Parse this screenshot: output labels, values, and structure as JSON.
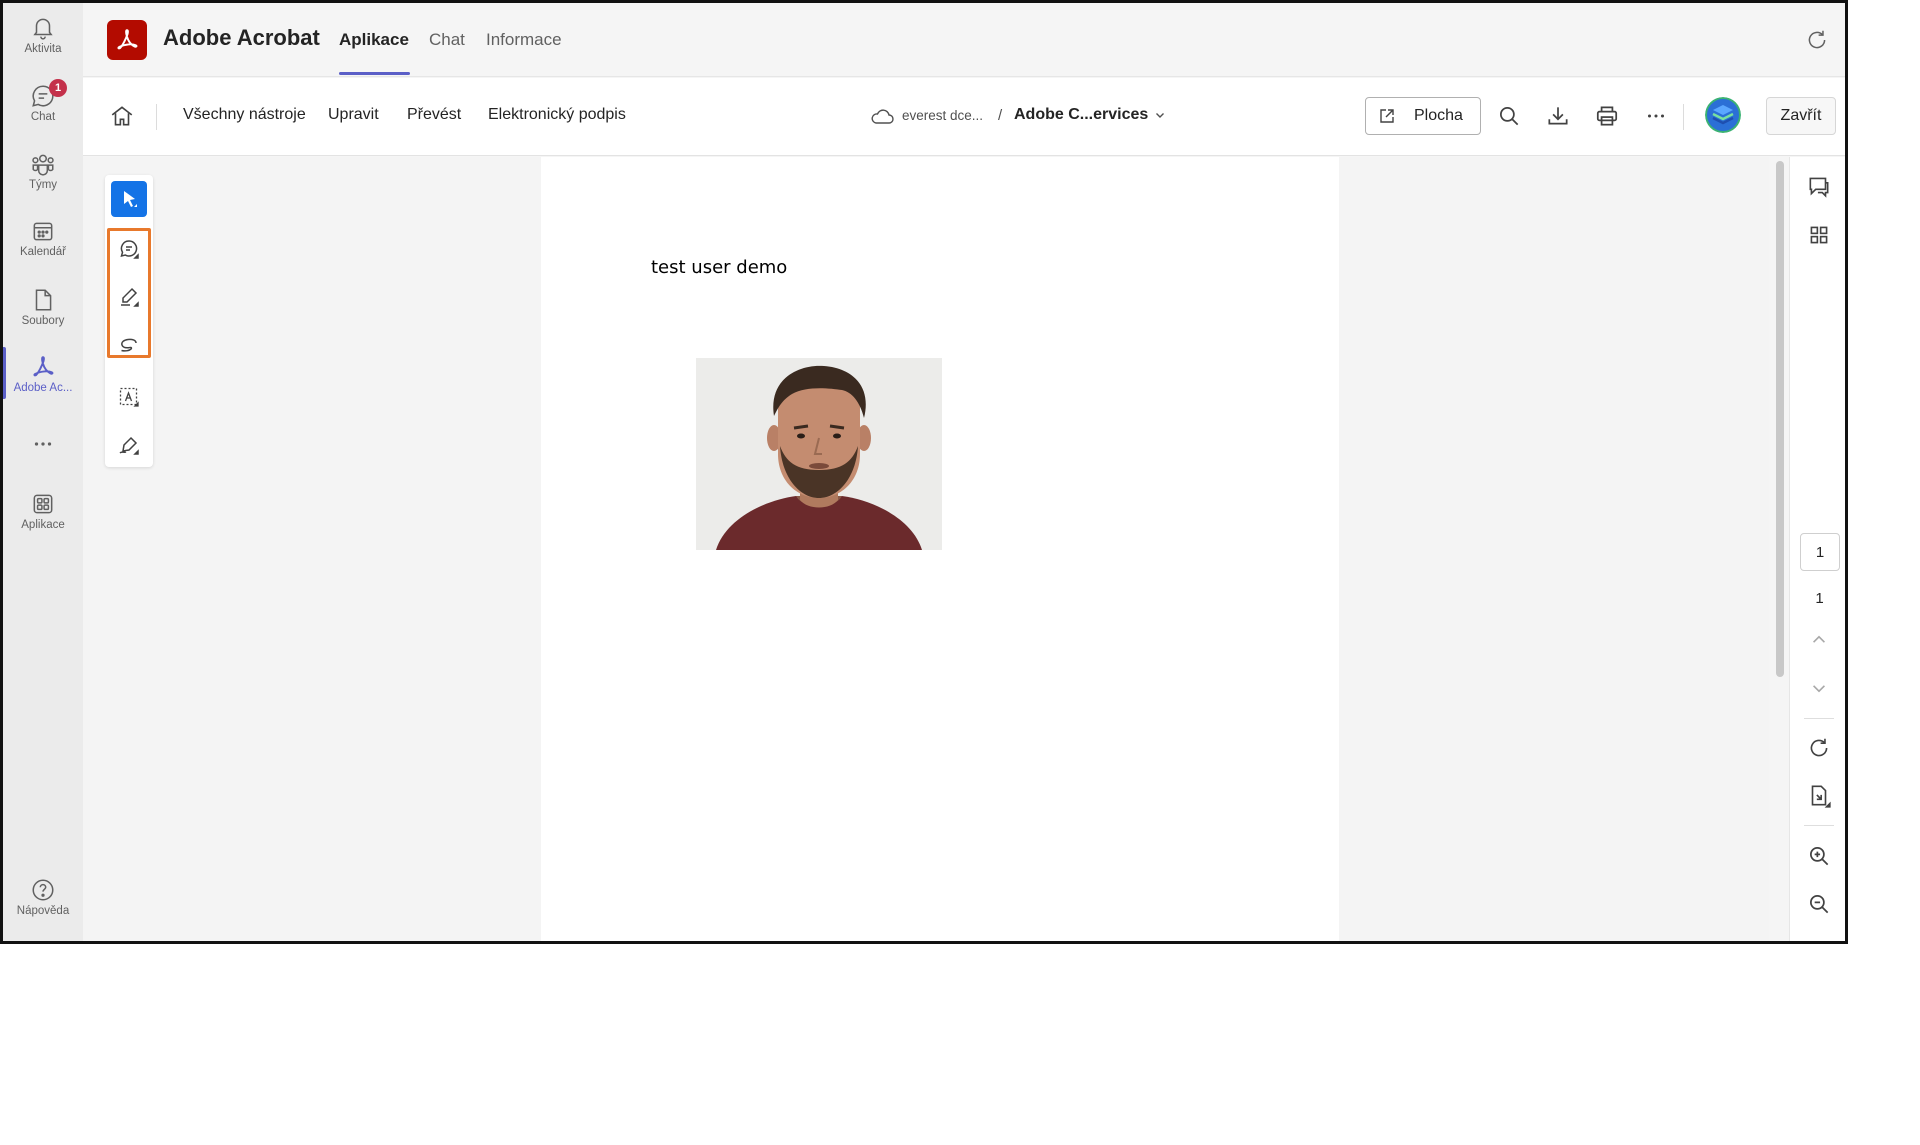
{
  "rail": {
    "items": [
      {
        "label": "Aktivita",
        "icon": "bell-icon"
      },
      {
        "label": "Chat",
        "icon": "chat-icon",
        "badge": "1"
      },
      {
        "label": "Týmy",
        "icon": "teams-icon"
      },
      {
        "label": "Kalendář",
        "icon": "calendar-icon"
      },
      {
        "label": "Soubory",
        "icon": "file-icon"
      },
      {
        "label": "Adobe Ac...",
        "icon": "acrobat-icon"
      },
      {
        "label": "",
        "icon": "more-horizontal-icon"
      },
      {
        "label": "Aplikace",
        "icon": "apps-icon"
      }
    ],
    "help_label": "Nápověda",
    "active_color": "#5b5fc7"
  },
  "header": {
    "app_title": "Adobe Acrobat",
    "tabs": [
      {
        "label": "Aplikace",
        "active": true
      },
      {
        "label": "Chat",
        "active": false
      },
      {
        "label": "Informace",
        "active": false
      }
    ],
    "brand_color": "#b30b00"
  },
  "toolbar": {
    "menu": [
      "Všechny nástroje",
      "Upravit",
      "Převést",
      "Elektronický podpis"
    ],
    "breadcrumb_location": "everest dce...",
    "breadcrumb_separator": "/",
    "breadcrumb_file": "Adobe C...ervices",
    "plocha_label": "Plocha",
    "close_label": "Zavřít"
  },
  "tools": [
    {
      "name": "select-tool",
      "selected": true
    },
    {
      "name": "comment-tool",
      "selected": false
    },
    {
      "name": "highlight-pen-tool",
      "selected": false
    },
    {
      "name": "freehand-draw-tool",
      "selected": false
    },
    {
      "name": "text-box-tool",
      "selected": false
    },
    {
      "name": "signature-tool",
      "selected": false
    }
  ],
  "document": {
    "text": "test user demo"
  },
  "right_panel": {
    "current_page": "1",
    "total_pages": "1"
  }
}
